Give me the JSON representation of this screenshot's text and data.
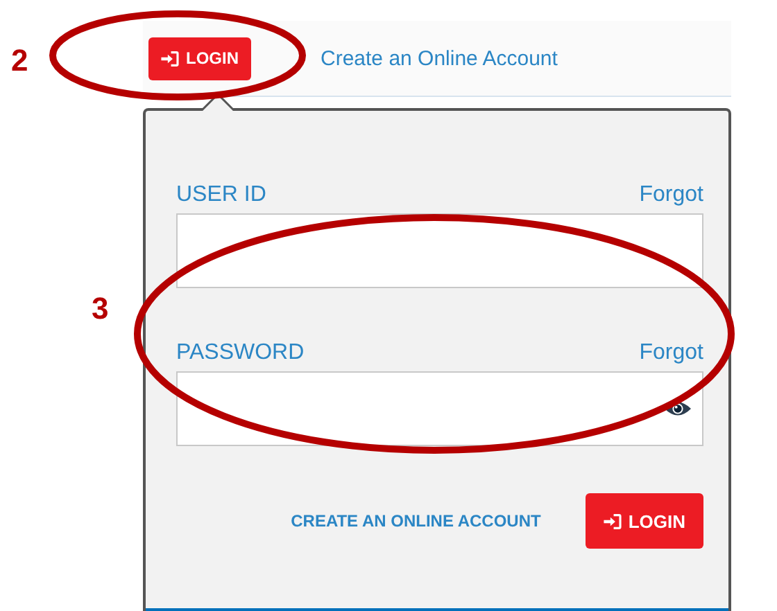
{
  "header": {
    "login_button": "LOGIN",
    "create_account_link": "Create an Online Account"
  },
  "login_popup": {
    "fields": [
      {
        "label": "USER ID",
        "forgot_link": "Forgot",
        "kind": "text"
      },
      {
        "label": "PASSWORD",
        "forgot_link": "Forgot",
        "kind": "password"
      }
    ],
    "create_account_link": "CREATE AN ONLINE ACCOUNT",
    "login_button": "LOGIN"
  },
  "annotations": [
    {
      "number": "2"
    },
    {
      "number": "3"
    }
  ]
}
